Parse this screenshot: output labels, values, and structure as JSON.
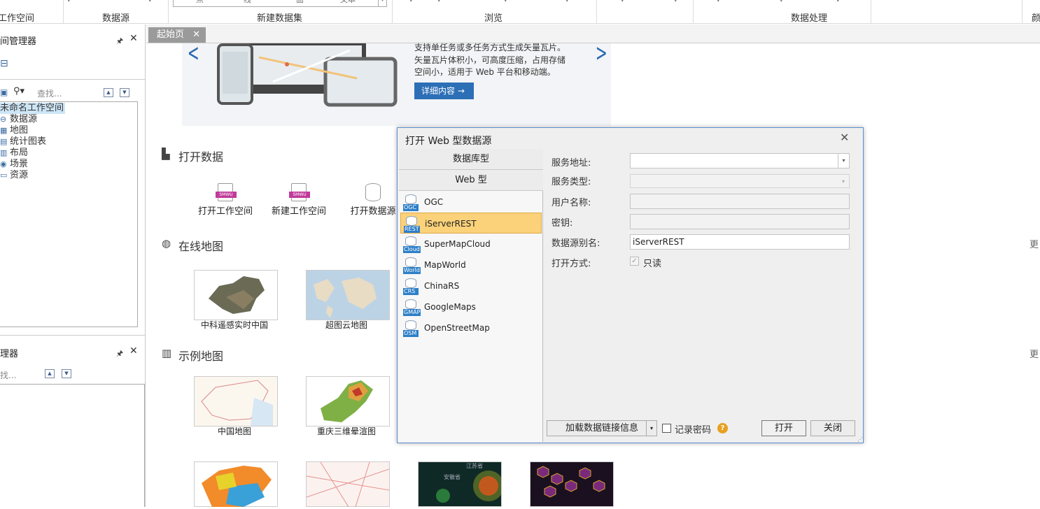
{
  "ribbon": {
    "groups": [
      "工作空间",
      "数据源",
      "新建数据集",
      "浏览",
      "数据处理",
      "颜"
    ],
    "input_partial": [
      "点",
      "线",
      "面",
      "文本"
    ]
  },
  "workspace_panel": {
    "title": "间管理器",
    "search_placeholder": "查找...",
    "tree": [
      {
        "label": "未命名工作空间",
        "icon": "workspace-icon",
        "selected": true
      },
      {
        "label": "数据源",
        "icon": "datasource-icon"
      },
      {
        "label": "地图",
        "icon": "map-icon"
      },
      {
        "label": "统计图表",
        "icon": "chart-icon"
      },
      {
        "label": "布局",
        "icon": "layout-icon"
      },
      {
        "label": "场景",
        "icon": "scene-icon"
      },
      {
        "label": "资源",
        "icon": "folder-icon"
      }
    ]
  },
  "layer_panel": {
    "title": "理器",
    "search_placeholder": "找..."
  },
  "tabs": [
    {
      "label": "起始页"
    }
  ],
  "banner": {
    "lines": [
      "支持单任务或多任务方式生成矢量瓦片。",
      "矢量瓦片体积小，可高度压缩，占用存储",
      "空间小，适用于 Web 平台和移动端。"
    ],
    "detail_button": "详细内容 →"
  },
  "sections": {
    "open_data": {
      "title": "打开数据",
      "actions": [
        "打开工作空间",
        "新建工作空间",
        "打开数据源"
      ],
      "badge": "SMWU"
    },
    "online_maps": {
      "title": "在线地图",
      "items": [
        "中科遥感实时中国",
        "超图云地图"
      ],
      "more": "更"
    },
    "sample_maps": {
      "title": "示例地图",
      "items": [
        "中国地图",
        "重庆三维晕渲图"
      ],
      "more": "更"
    },
    "heatmap_labels": [
      "江苏省",
      "安徽省"
    ]
  },
  "dialog": {
    "title": "打开 Web 型数据源",
    "categories": [
      "数据库型",
      "Web 型"
    ],
    "sources": [
      {
        "label": "OGC",
        "badge": "OGC"
      },
      {
        "label": "iServerREST",
        "badge": "REST",
        "selected": true
      },
      {
        "label": "SuperMapCloud",
        "badge": "Cloud"
      },
      {
        "label": "MapWorld",
        "badge": "World"
      },
      {
        "label": "ChinaRS",
        "badge": "CRS"
      },
      {
        "label": "GoogleMaps",
        "badge": "GMAP"
      },
      {
        "label": "OpenStreetMap",
        "badge": "OSM"
      }
    ],
    "fields": {
      "service_url_label": "服务地址:",
      "service_url_value": "",
      "service_type_label": "服务类型:",
      "username_label": "用户名称:",
      "password_label": "密钥:",
      "alias_label": "数据源别名:",
      "alias_value": "iServerREST",
      "open_mode_label": "打开方式:",
      "readonly_label": "只读",
      "readonly_checked": true
    },
    "footer": {
      "load_button": "加载数据链接信息",
      "remember_label": "记录密码",
      "remember_checked": false,
      "open_button": "打开",
      "close_button": "关闭"
    }
  },
  "colors": {
    "accent": "#2d6fb6",
    "highlight": "#e53b3b",
    "selection": "#fbd27a"
  }
}
